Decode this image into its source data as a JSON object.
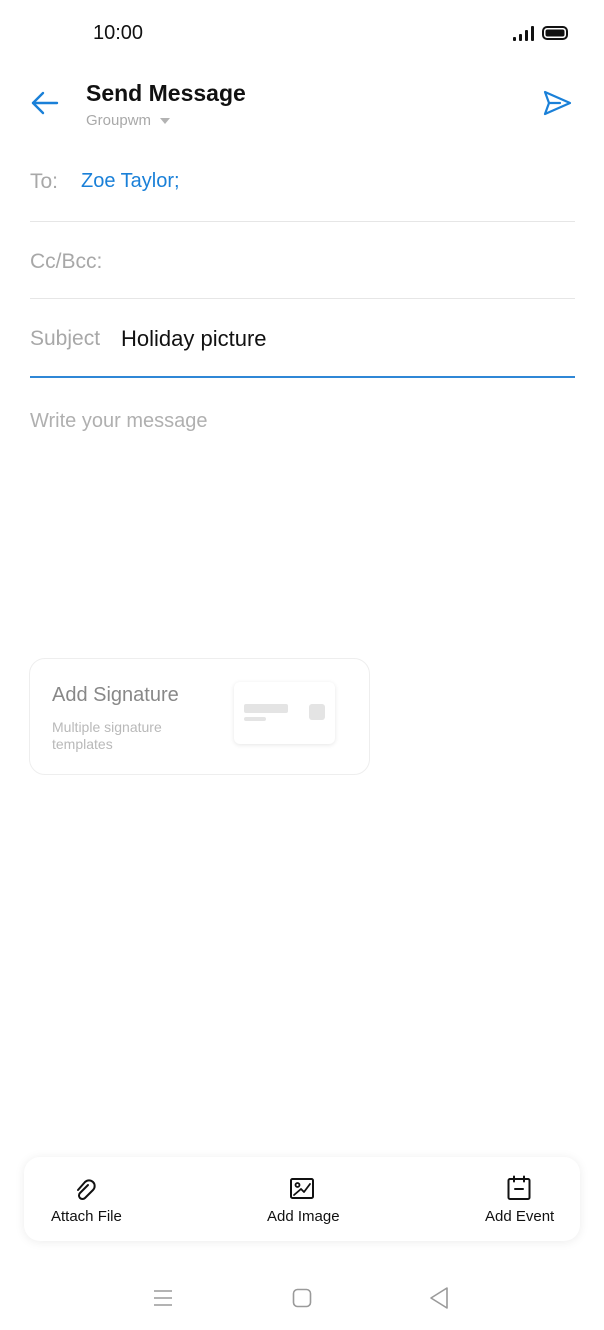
{
  "status_bar": {
    "time": "10:00"
  },
  "header": {
    "title": "Send Message",
    "account": "Groupwm",
    "back_icon": "arrow-left-icon",
    "send_icon": "send-icon"
  },
  "fields": {
    "to_label": "To:",
    "to_value": "Zoe Taylor;",
    "cc_label": "Cc/Bcc:",
    "subject_label": "Subject",
    "subject_value": "Holiday picture",
    "message_placeholder": "Write your message"
  },
  "signature": {
    "title": "Add Signature",
    "subtitle": "Multiple signature templates"
  },
  "toolbar": {
    "attach_label": "Attach File",
    "image_label": "Add Image",
    "event_label": "Add Event"
  },
  "colors": {
    "accent": "#1a80d8",
    "label_gray": "#a8a8a8",
    "divider": "#e6e6e6"
  }
}
